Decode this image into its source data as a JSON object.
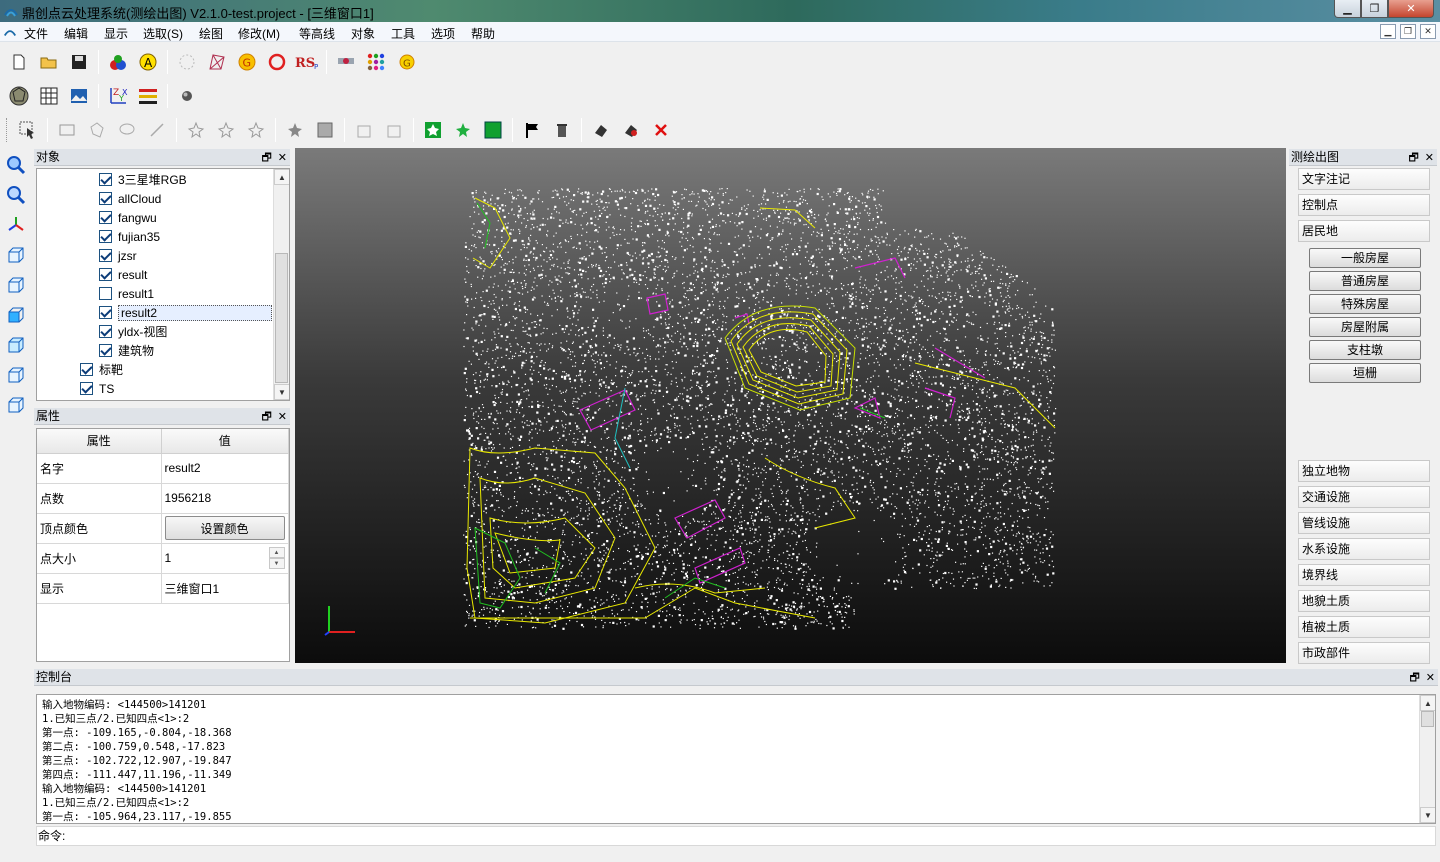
{
  "window": {
    "title": "鼎创点云处理系统(测绘出图) V2.1.0-test.project - [三维窗口1]"
  },
  "menu": [
    "文件",
    "编辑",
    "显示",
    "选取(S)",
    "绘图",
    "修改(M)",
    "等高线",
    "对象",
    "工具",
    "选项",
    "帮助"
  ],
  "objects_panel": {
    "title": "对象",
    "items": [
      {
        "label": "3三星堆RGB",
        "checked": true,
        "level": 2
      },
      {
        "label": "allCloud",
        "checked": true,
        "level": 2
      },
      {
        "label": "fangwu",
        "checked": true,
        "level": 2
      },
      {
        "label": "fujian35",
        "checked": true,
        "level": 2
      },
      {
        "label": "jzsr",
        "checked": true,
        "level": 2
      },
      {
        "label": "result",
        "checked": true,
        "level": 2
      },
      {
        "label": "result1",
        "checked": false,
        "level": 2
      },
      {
        "label": "result2",
        "checked": true,
        "level": 2,
        "selected": true
      },
      {
        "label": "yldx-视图",
        "checked": true,
        "level": 2
      },
      {
        "label": "建筑物",
        "checked": true,
        "level": 2
      },
      {
        "label": "标靶",
        "checked": true,
        "level": 1
      },
      {
        "label": "TS",
        "checked": true,
        "level": 1
      }
    ]
  },
  "properties_panel": {
    "title": "属性",
    "col_property": "属性",
    "col_value": "值",
    "rows": {
      "name_key": "名字",
      "name_val": "result2",
      "count_key": "点数",
      "count_val": "1956218",
      "color_key": "顶点颜色",
      "color_btn": "设置颜色",
      "size_key": "点大小",
      "size_val": "1",
      "display_key": "显示",
      "display_val": "三维窗口1"
    }
  },
  "mapping_panel": {
    "title": "测绘出图",
    "top_items": [
      "文字注记",
      "控制点",
      "居民地"
    ],
    "sub_items": [
      "一般房屋",
      "普通房屋",
      "特殊房屋",
      "房屋附属",
      "支柱墩",
      "垣栅"
    ],
    "bottom_items": [
      "独立地物",
      "交通设施",
      "管线设施",
      "水系设施",
      "境界线",
      "地貌土质",
      "植被土质",
      "市政部件"
    ]
  },
  "console": {
    "title": "控制台",
    "lines": [
      "输入地物编码: <144500>141201",
      "1.已知三点/2.已知四点<1>:2",
      "第一点: -109.165,-0.804,-18.368",
      "第二点: -100.759,0.548,-17.823",
      "第三点: -102.722,12.907,-19.847",
      "第四点: -111.447,11.196,-11.349",
      "输入地物编码: <144500>141201",
      "1.已知三点/2.已知四点<1>:2",
      "第一点: -105.964,23.117,-19.855"
    ],
    "command_label": "命令:"
  },
  "colors": {
    "contour_yellow": "#e8e800",
    "boundary_magenta": "#d020d0",
    "green": "#20c020",
    "cyan": "#20c0c0"
  }
}
